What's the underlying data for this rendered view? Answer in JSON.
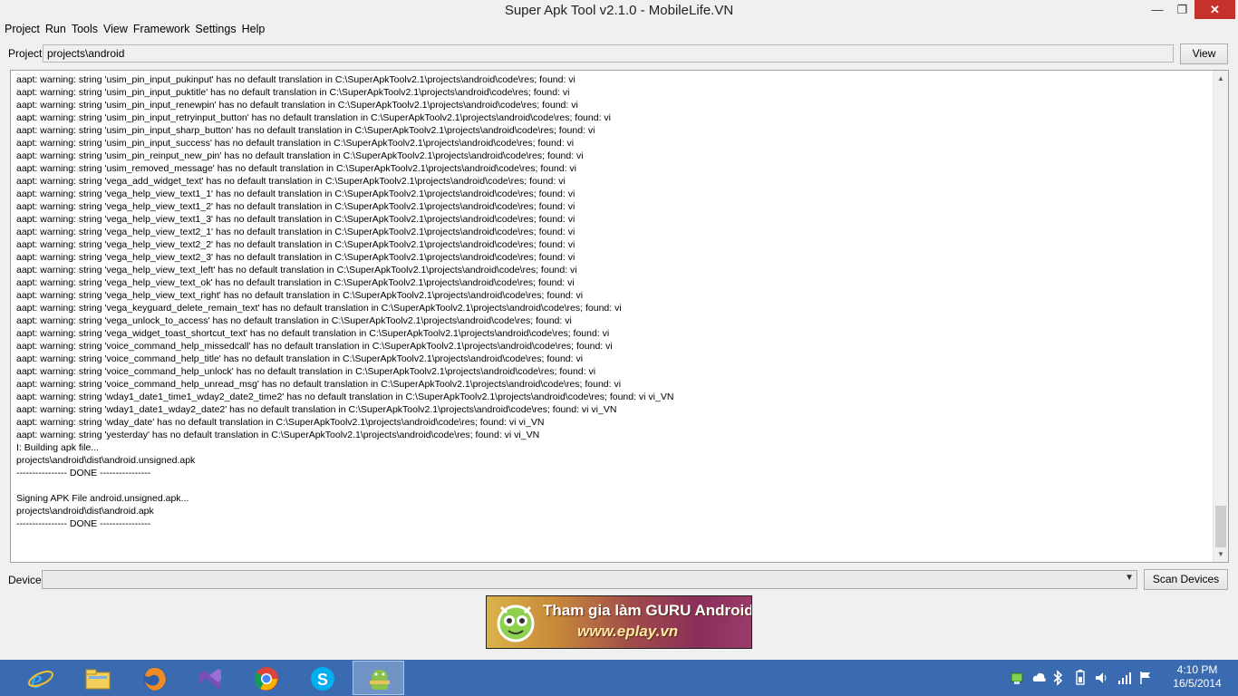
{
  "window": {
    "title": "Super Apk Tool v2.1.0 - MobileLife.VN",
    "minimize": "—",
    "maximize": "❐",
    "close": "✕"
  },
  "menu": [
    "Project",
    "Run",
    "Tools",
    "View",
    "Framework",
    "Settings",
    "Help"
  ],
  "project": {
    "label": "Project",
    "value": "projects\\android",
    "view_button": "View"
  },
  "log": {
    "lines": [
      "aapt: warning: string 'usim_pin_input_pukinput' has no default translation in C:\\SuperApkToolv2.1\\projects\\android\\code\\res; found: vi",
      "aapt: warning: string 'usim_pin_input_puktitle' has no default translation in C:\\SuperApkToolv2.1\\projects\\android\\code\\res; found: vi",
      "aapt: warning: string 'usim_pin_input_renewpin' has no default translation in C:\\SuperApkToolv2.1\\projects\\android\\code\\res; found: vi",
      "aapt: warning: string 'usim_pin_input_retryinput_button' has no default translation in C:\\SuperApkToolv2.1\\projects\\android\\code\\res; found: vi",
      "aapt: warning: string 'usim_pin_input_sharp_button' has no default translation in C:\\SuperApkToolv2.1\\projects\\android\\code\\res; found: vi",
      "aapt: warning: string 'usim_pin_input_success' has no default translation in C:\\SuperApkToolv2.1\\projects\\android\\code\\res; found: vi",
      "aapt: warning: string 'usim_pin_reinput_new_pin' has no default translation in C:\\SuperApkToolv2.1\\projects\\android\\code\\res; found: vi",
      "aapt: warning: string 'usim_removed_message' has no default translation in C:\\SuperApkToolv2.1\\projects\\android\\code\\res; found: vi",
      "aapt: warning: string 'vega_add_widget_text' has no default translation in C:\\SuperApkToolv2.1\\projects\\android\\code\\res; found: vi",
      "aapt: warning: string 'vega_help_view_text1_1' has no default translation in C:\\SuperApkToolv2.1\\projects\\android\\code\\res; found: vi",
      "aapt: warning: string 'vega_help_view_text1_2' has no default translation in C:\\SuperApkToolv2.1\\projects\\android\\code\\res; found: vi",
      "aapt: warning: string 'vega_help_view_text1_3' has no default translation in C:\\SuperApkToolv2.1\\projects\\android\\code\\res; found: vi",
      "aapt: warning: string 'vega_help_view_text2_1' has no default translation in C:\\SuperApkToolv2.1\\projects\\android\\code\\res; found: vi",
      "aapt: warning: string 'vega_help_view_text2_2' has no default translation in C:\\SuperApkToolv2.1\\projects\\android\\code\\res; found: vi",
      "aapt: warning: string 'vega_help_view_text2_3' has no default translation in C:\\SuperApkToolv2.1\\projects\\android\\code\\res; found: vi",
      "aapt: warning: string 'vega_help_view_text_left' has no default translation in C:\\SuperApkToolv2.1\\projects\\android\\code\\res; found: vi",
      "aapt: warning: string 'vega_help_view_text_ok' has no default translation in C:\\SuperApkToolv2.1\\projects\\android\\code\\res; found: vi",
      "aapt: warning: string 'vega_help_view_text_right' has no default translation in C:\\SuperApkToolv2.1\\projects\\android\\code\\res; found: vi",
      "aapt: warning: string 'vega_keyguard_delete_remain_text' has no default translation in C:\\SuperApkToolv2.1\\projects\\android\\code\\res; found: vi",
      "aapt: warning: string 'vega_unlock_to_access' has no default translation in C:\\SuperApkToolv2.1\\projects\\android\\code\\res; found: vi",
      "aapt: warning: string 'vega_widget_toast_shortcut_text' has no default translation in C:\\SuperApkToolv2.1\\projects\\android\\code\\res; found: vi",
      "aapt: warning: string 'voice_command_help_missedcall' has no default translation in C:\\SuperApkToolv2.1\\projects\\android\\code\\res; found: vi",
      "aapt: warning: string 'voice_command_help_title' has no default translation in C:\\SuperApkToolv2.1\\projects\\android\\code\\res; found: vi",
      "aapt: warning: string 'voice_command_help_unlock' has no default translation in C:\\SuperApkToolv2.1\\projects\\android\\code\\res; found: vi",
      "aapt: warning: string 'voice_command_help_unread_msg' has no default translation in C:\\SuperApkToolv2.1\\projects\\android\\code\\res; found: vi",
      "aapt: warning: string 'wday1_date1_time1_wday2_date2_time2' has no default translation in C:\\SuperApkToolv2.1\\projects\\android\\code\\res; found: vi vi_VN",
      "aapt: warning: string 'wday1_date1_wday2_date2' has no default translation in C:\\SuperApkToolv2.1\\projects\\android\\code\\res; found: vi vi_VN",
      "aapt: warning: string 'wday_date' has no default translation in C:\\SuperApkToolv2.1\\projects\\android\\code\\res; found: vi vi_VN",
      "aapt: warning: string 'yesterday' has no default translation in C:\\SuperApkToolv2.1\\projects\\android\\code\\res; found: vi vi_VN",
      "I: Building apk file...",
      "projects\\android\\dist\\android.unsigned.apk",
      "---------------- DONE ----------------",
      "",
      "Signing APK File android.unsigned.apk...",
      "projects\\android\\dist\\android.apk",
      "---------------- DONE ----------------"
    ]
  },
  "device": {
    "label": "Device",
    "value": "",
    "scan_button": "Scan Devices"
  },
  "banner": {
    "line1": "Tham gia làm GURU Android",
    "line2": "www.eplay.vn"
  },
  "taskbar": {
    "apps": [
      {
        "name": "internet-explorer-icon",
        "active": false
      },
      {
        "name": "file-explorer-icon",
        "active": false
      },
      {
        "name": "firefox-icon",
        "active": false
      },
      {
        "name": "visual-studio-icon",
        "active": false
      },
      {
        "name": "chrome-icon",
        "active": false
      },
      {
        "name": "skype-icon",
        "active": false
      },
      {
        "name": "super-apk-tool-icon",
        "active": true
      }
    ],
    "tray_icons": [
      "network-share-icon",
      "cloud-icon",
      "bluetooth-icon",
      "power-icon",
      "volume-icon",
      "signal-icon",
      "flag-icon"
    ],
    "time": "4:10 PM",
    "date": "16/5/2014"
  },
  "colors": {
    "taskbar": "#3a6bb0",
    "close_button": "#c7312b",
    "window_bg": "#f0f0f0"
  }
}
